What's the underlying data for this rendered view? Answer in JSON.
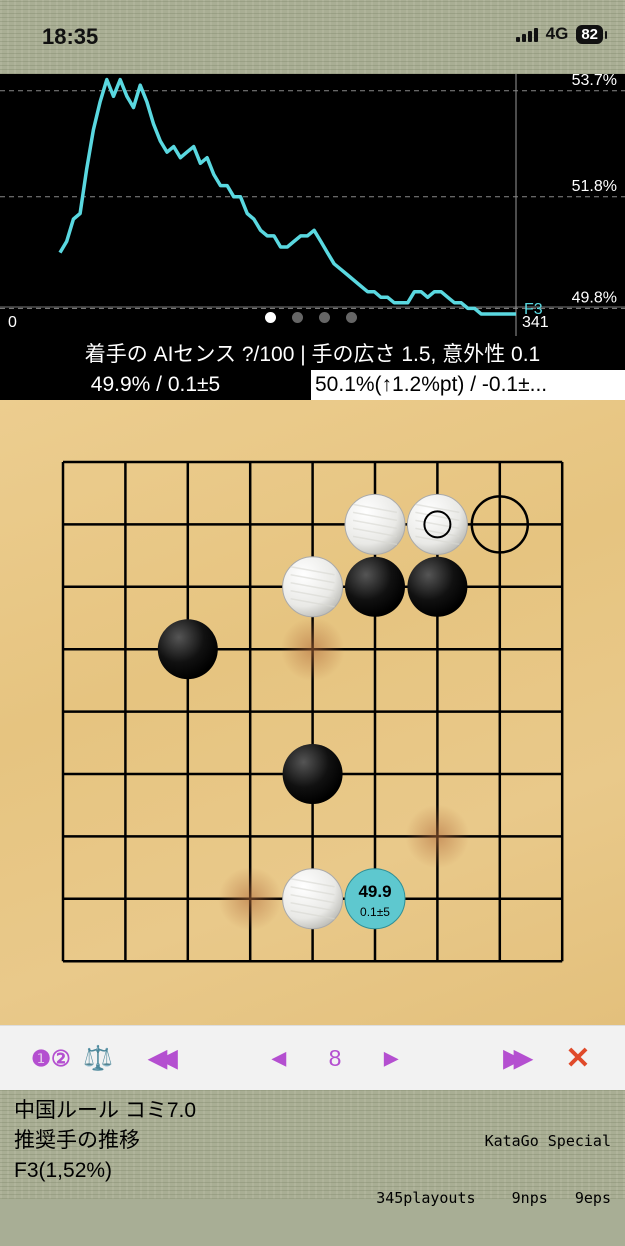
{
  "status_bar": {
    "time": "18:35",
    "network": "4G",
    "battery": "82"
  },
  "chart": {
    "y_labels": [
      "53.7%",
      "51.8%",
      "49.8%"
    ],
    "x_start": "0",
    "x_end": "341",
    "last_move_label": "F3",
    "line_color": "#5ad8e0",
    "page_count": 4,
    "active_page": 0
  },
  "chart_data": {
    "type": "line",
    "title": "",
    "xlabel": "",
    "ylabel": "",
    "xlim": [
      0,
      341
    ],
    "ylim": [
      49.7,
      54.0
    ],
    "y_ticks": [
      53.7,
      51.8,
      49.8
    ],
    "grid": "dashed horizontal",
    "series": [
      {
        "x": [
          0,
          5,
          10,
          15,
          20,
          25,
          30,
          35,
          40,
          45,
          50,
          55,
          60,
          65,
          70,
          75,
          80,
          85,
          90,
          95,
          100,
          105,
          110,
          115,
          120,
          125,
          130,
          135,
          140,
          145,
          150,
          155,
          160,
          165,
          170,
          175,
          180,
          185,
          190,
          195,
          200,
          205,
          210,
          215,
          220,
          225,
          230,
          235,
          240,
          245,
          250,
          255,
          260,
          265,
          270,
          275,
          280,
          285,
          290,
          295,
          300,
          305,
          310,
          315,
          320,
          325,
          330,
          335,
          341
        ],
        "values": [
          50.8,
          51.0,
          51.4,
          51.5,
          52.3,
          53.0,
          53.5,
          53.9,
          53.6,
          53.9,
          53.6,
          53.4,
          53.8,
          53.5,
          53.1,
          52.8,
          52.6,
          52.7,
          52.5,
          52.6,
          52.7,
          52.4,
          52.5,
          52.2,
          52.0,
          52.0,
          51.8,
          51.8,
          51.5,
          51.4,
          51.2,
          51.1,
          51.1,
          50.9,
          50.9,
          51.0,
          51.1,
          51.1,
          51.2,
          51.0,
          50.8,
          50.6,
          50.5,
          50.4,
          50.3,
          50.2,
          50.1,
          50.1,
          50.0,
          50.0,
          49.9,
          49.9,
          49.9,
          50.1,
          50.1,
          50.0,
          50.1,
          50.1,
          50.0,
          49.9,
          49.9,
          49.8,
          49.8,
          49.7,
          49.7,
          49.7,
          49.7,
          49.7,
          49.7
        ]
      }
    ]
  },
  "caption": "着手の AIセンス ?/100 | 手の広さ 1.5, 意外性 0.1",
  "eval": {
    "black": "49.9% / 0.1±5",
    "white": "50.1%(↑1.2%pt) / -0.1±..."
  },
  "board": {
    "size": 9,
    "black_stones": [
      [
        5,
        2
      ],
      [
        6,
        2
      ],
      [
        2,
        3
      ],
      [
        4,
        5
      ]
    ],
    "white_stones": [
      [
        5,
        1
      ],
      [
        6,
        1
      ],
      [
        4,
        2
      ],
      [
        4,
        7
      ]
    ],
    "last_move": [
      6,
      1
    ],
    "empty_circle": [
      7,
      1
    ],
    "hint_spots": [
      [
        4,
        3
      ],
      [
        6,
        6
      ],
      [
        3,
        7
      ]
    ],
    "candidate": {
      "point": [
        5,
        7
      ],
      "winrate": "49.9",
      "score": "0.1±5",
      "color": "#5ec8cf"
    }
  },
  "controls": {
    "mode_label": "❶②",
    "balance_icon": "⚖️",
    "first_icon": "◀◀",
    "prev_icon": "◀",
    "move_number": "8",
    "next_icon": "▶",
    "last_icon": "▶▶",
    "close_icon": "✕",
    "accent_color": "#b44fd0",
    "close_color": "#e04a2a"
  },
  "footer": {
    "rules": "中国ルール コミ7.0",
    "mode": "推奨手の推移",
    "best_move": "F3(1,52%)",
    "engine": "KataGo Special",
    "playouts": "345playouts",
    "nps": "9nps",
    "eps": "9eps"
  }
}
